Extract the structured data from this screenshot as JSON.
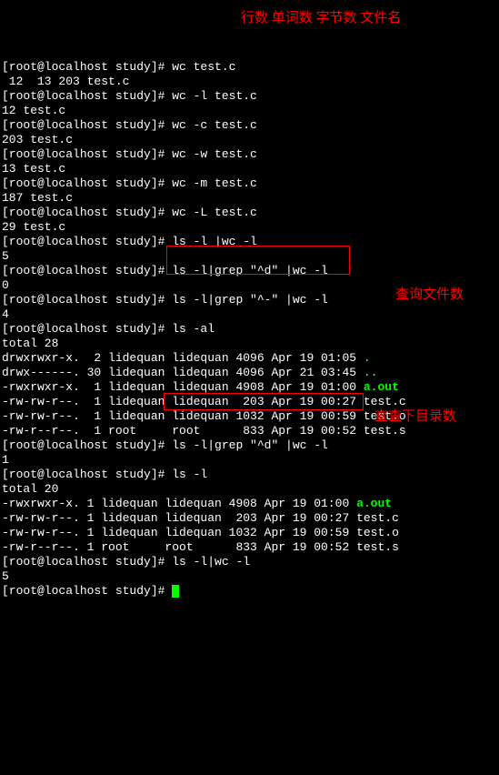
{
  "notes": {
    "header": "行数 单词数 字节数 文件名",
    "query_files": "查询文件数",
    "query_dirs": "查查下目录数"
  },
  "prompts": {
    "p": "[root@localhost study]# "
  },
  "cmds": {
    "wc": "wc test.c",
    "wc_out": " 12  13 203 test.c",
    "wcl": "wc -l test.c",
    "wcl_out": "12 test.c",
    "wcc": "wc -c test.c",
    "wcc_out": "203 test.c",
    "wcw": "wc -w test.c",
    "wcw_out": "13 test.c",
    "wcm": "wc -m test.c",
    "wcm_out": "187 test.c",
    "wcL": "wc -L test.c",
    "wcL_out": "29 test.c",
    "lslwc": "ls -l |wc -l",
    "lslwc_out": "5",
    "lsgrepd": "ls -l|grep \"^d\" |wc -l",
    "lsgrepd_out": "0",
    "lsgrepdash": "ls -l|grep \"^-\" |wc -l",
    "lsgrepdash_out": "4",
    "lsal": "ls -al",
    "total28": "total 28",
    "lsgrepd2": "ls -l|grep \"^d\" |wc -l",
    "lsgrepd2_out": "1",
    "lsl": "ls -l",
    "total20": "total 20",
    "lslwc2": "ls -l|wc -l",
    "lslwc2_out": "5"
  },
  "listing1": [
    {
      "perm": "drwxrwxr-x.",
      "n": "  2",
      "u": "lidequan",
      "g": "lidequan",
      "sz": "4096",
      "d": "Apr 19 01:05",
      "name": ".",
      "cls": "cyan"
    },
    {
      "perm": "drwx------.",
      "n": " 30",
      "u": "lidequan",
      "g": "lidequan",
      "sz": "4096",
      "d": "Apr 21 03:45",
      "name": "..",
      "cls": "cyan"
    },
    {
      "perm": "-rwxrwxr-x.",
      "n": "  1",
      "u": "lidequan",
      "g": "lidequan",
      "sz": "4908",
      "d": "Apr 19 01:00",
      "name": "a.out",
      "cls": "lime"
    },
    {
      "perm": "-rw-rw-r--.",
      "n": "  1",
      "u": "lidequan",
      "g": "lidequan",
      "sz": " 203",
      "d": "Apr 19 00:27",
      "name": "test.c",
      "cls": ""
    },
    {
      "perm": "-rw-rw-r--.",
      "n": "  1",
      "u": "lidequan",
      "g": "lidequan",
      "sz": "1032",
      "d": "Apr 19 00:59",
      "name": "test.o",
      "cls": ""
    },
    {
      "perm": "-rw-r--r--.",
      "n": "  1",
      "u": "root    ",
      "g": "root    ",
      "sz": " 833",
      "d": "Apr 19 00:52",
      "name": "test.s",
      "cls": ""
    }
  ],
  "listing2": [
    {
      "perm": "-rwxrwxr-x.",
      "n": " 1",
      "u": "lidequan",
      "g": "lidequan",
      "sz": "4908",
      "d": "Apr 19 01:00",
      "name": "a.out",
      "cls": "lime"
    },
    {
      "perm": "-rw-rw-r--.",
      "n": " 1",
      "u": "lidequan",
      "g": "lidequan",
      "sz": " 203",
      "d": "Apr 19 00:27",
      "name": "test.c",
      "cls": ""
    },
    {
      "perm": "-rw-rw-r--.",
      "n": " 1",
      "u": "lidequan",
      "g": "lidequan",
      "sz": "1032",
      "d": "Apr 19 00:59",
      "name": "test.o",
      "cls": ""
    },
    {
      "perm": "-rw-r--r--.",
      "n": " 1",
      "u": "root    ",
      "g": "root    ",
      "sz": " 833",
      "d": "Apr 19 00:52",
      "name": "test.s",
      "cls": ""
    }
  ]
}
